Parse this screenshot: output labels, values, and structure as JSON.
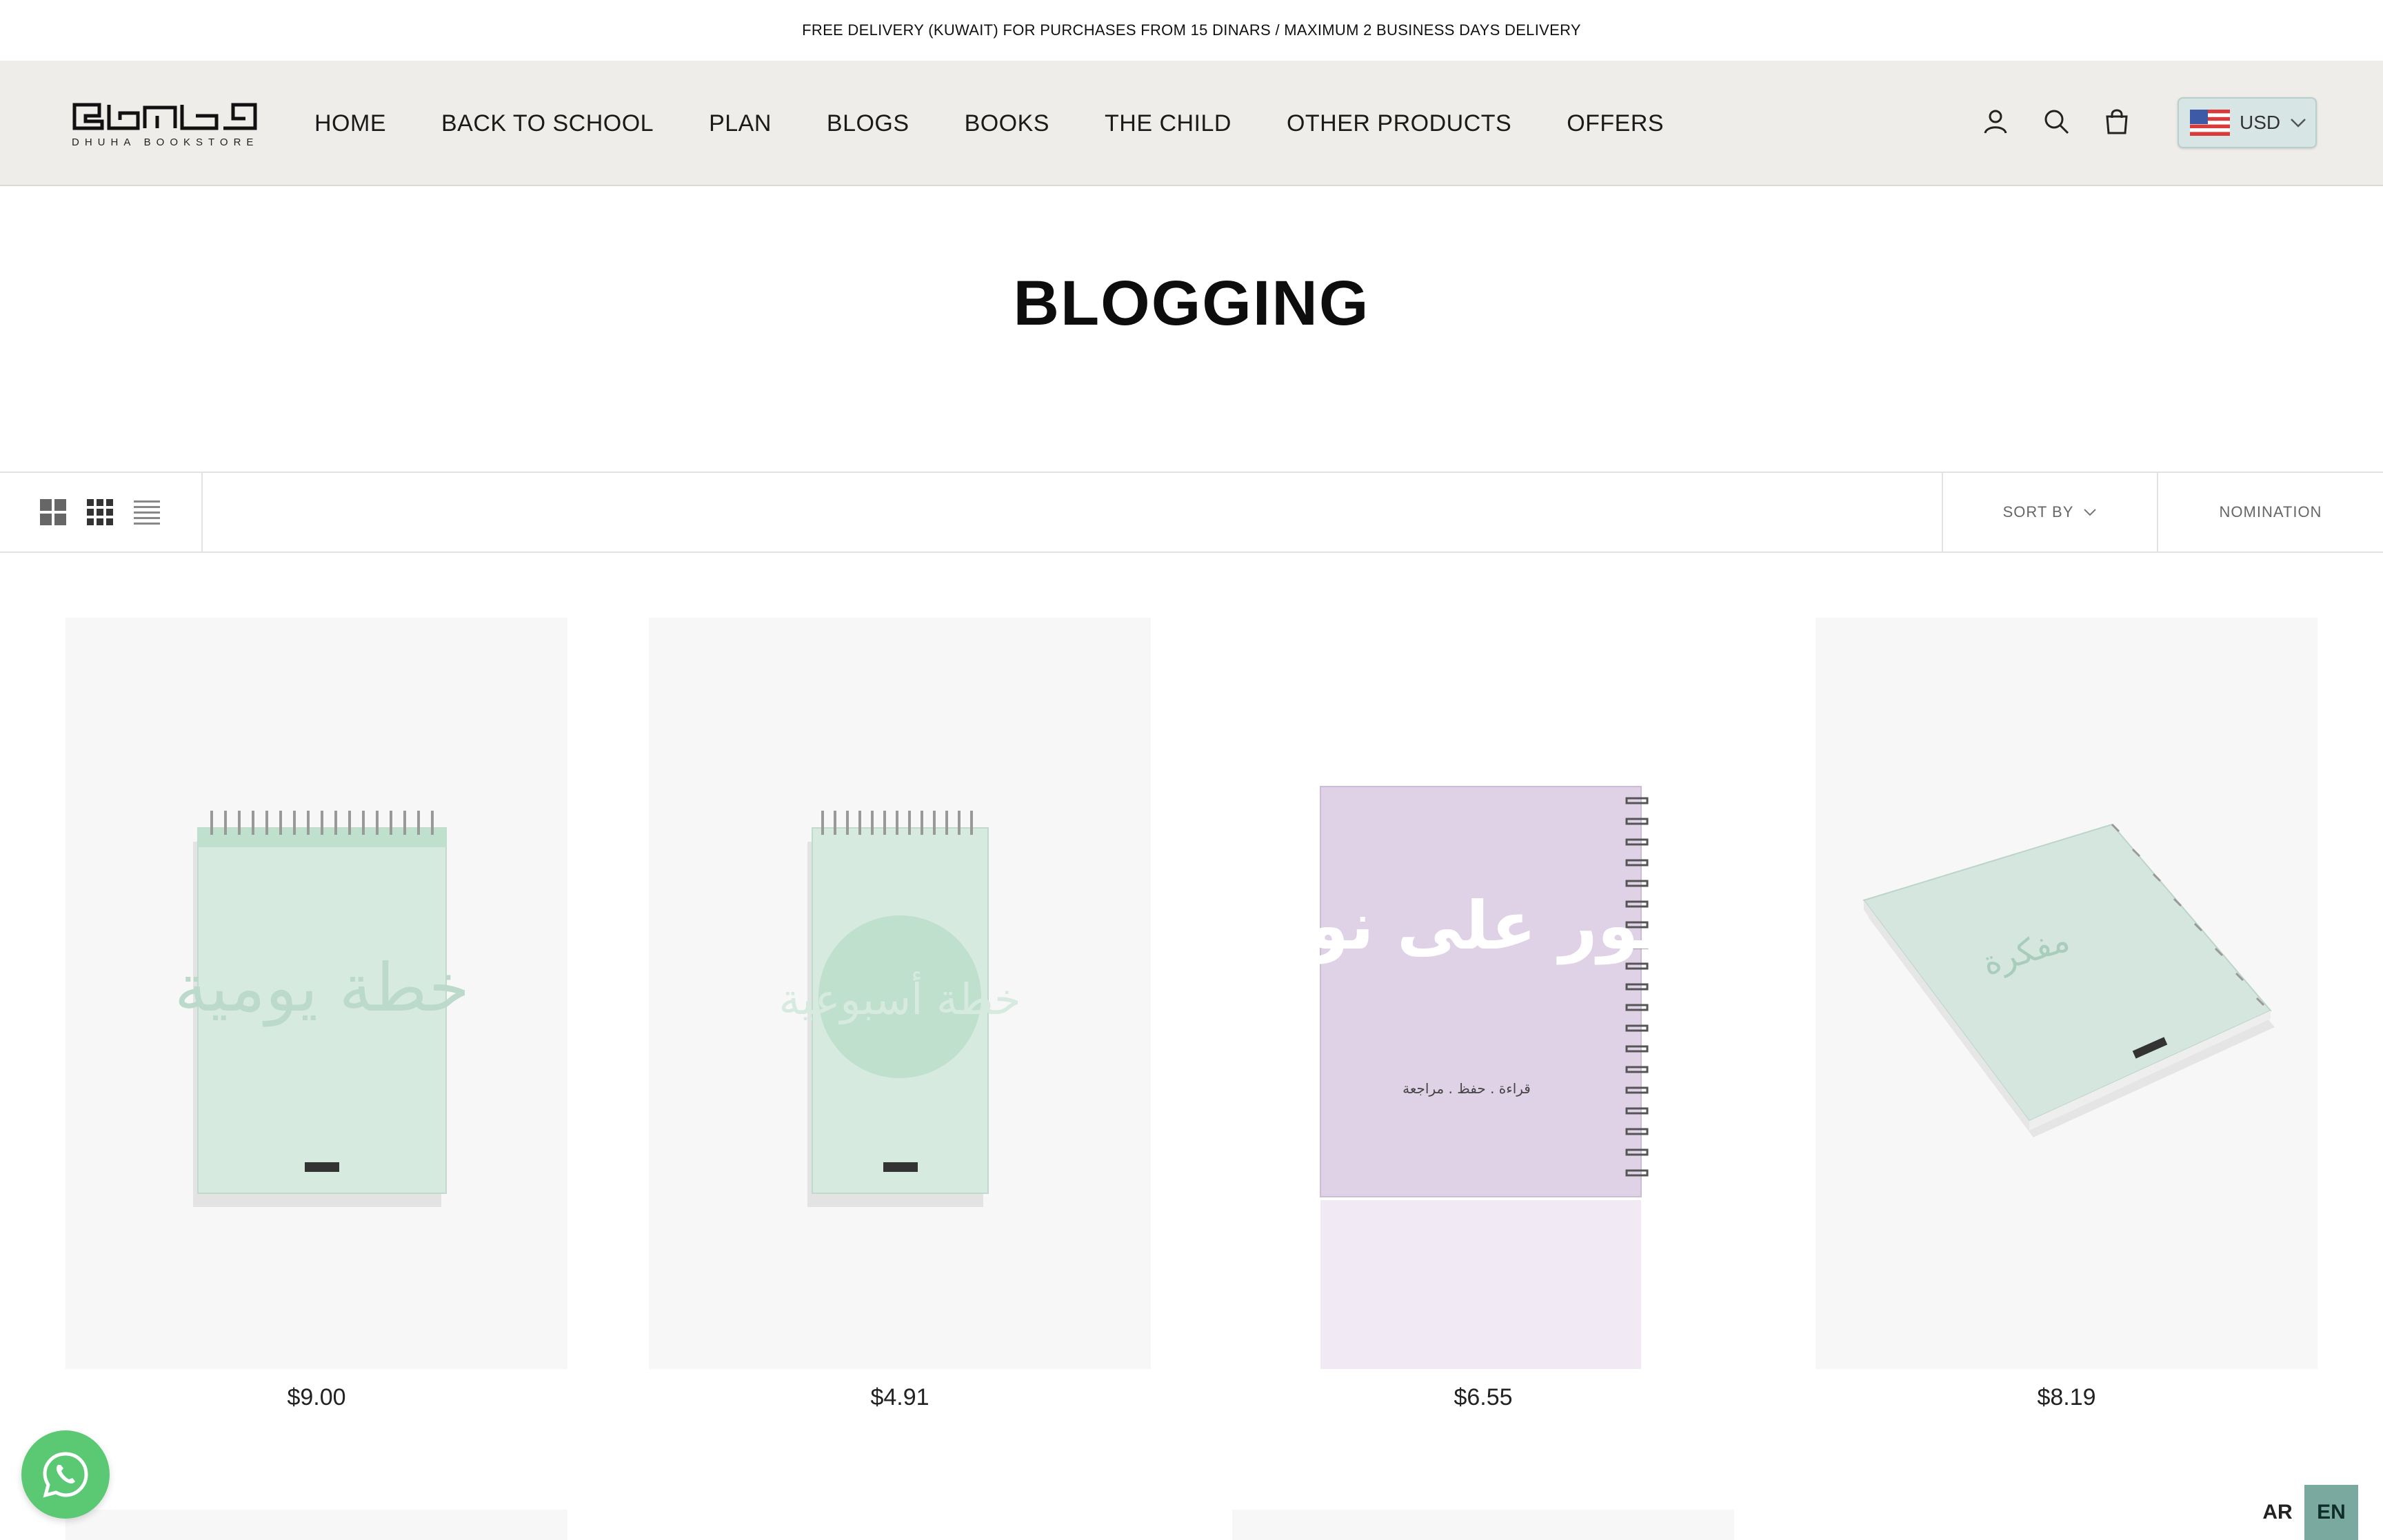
{
  "announcement": "FREE DELIVERY (KUWAIT) FOR PURCHASES FROM 15 DINARS / MAXIMUM 2 BUSINESS DAYS DELIVERY",
  "logo": {
    "arabic_text": "مكتبة ضحى",
    "subtitle": "DHUHA BOOKSTORE"
  },
  "nav": [
    "HOME",
    "BACK TO SCHOOL",
    "PLAN",
    "BLOGS",
    "BOOKS",
    "THE CHILD",
    "OTHER PRODUCTS",
    "OFFERS"
  ],
  "header_icons": [
    "account-icon",
    "search-icon",
    "cart-icon"
  ],
  "currency": {
    "label": "USD",
    "flag": "us-flag-icon"
  },
  "page_title": "BLOGGING",
  "toolbar": {
    "views": [
      "grid-2-icon",
      "grid-4-icon",
      "list-icon"
    ],
    "sort_label": "SORT BY",
    "filter_label": "NOMINATION"
  },
  "products": [
    {
      "price": "$9.00",
      "cover_color": "#d6eadf",
      "cover_title": "خطة يومية"
    },
    {
      "price": "$4.91",
      "cover_color": "#d6eadf",
      "cover_title": "خطة أسبوعية"
    },
    {
      "price": "$6.55",
      "cover_color": "#e0d2e6",
      "cover_title": "نور على نور",
      "cover_subtitle": "قراءة . حفظ . مراجعة"
    },
    {
      "price": "$8.19",
      "cover_color": "#d4e6de",
      "cover_title": "مفكرة"
    }
  ],
  "lang": {
    "ar": "AR",
    "en": "EN"
  },
  "colors": {
    "header_bg": "#efede9",
    "accent": "#7aa9a0",
    "whatsapp": "#5bc873"
  }
}
